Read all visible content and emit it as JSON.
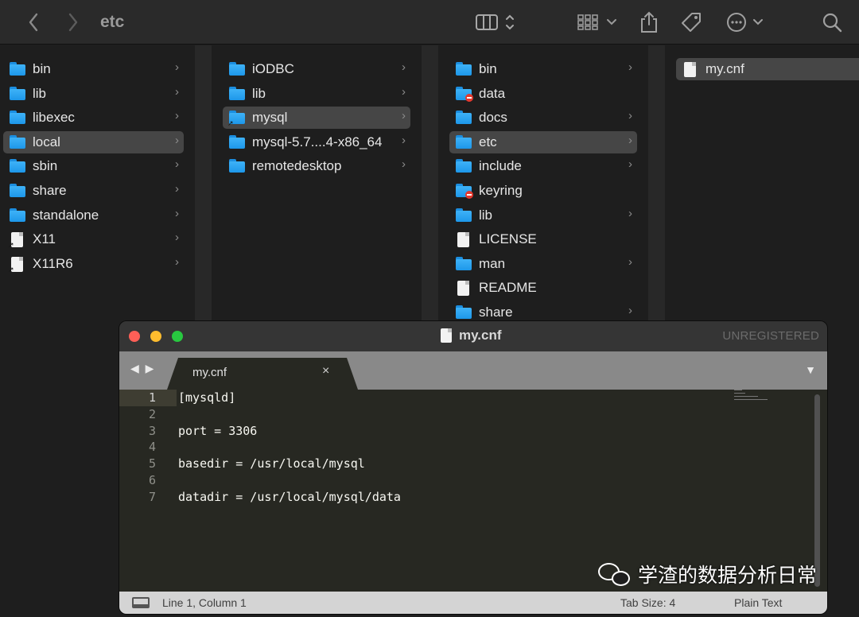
{
  "finder": {
    "title": "etc",
    "icons": {
      "back": "chevron-left-icon",
      "forward": "chevron-right-icon",
      "view": "column-view-icon",
      "group": "group-icon",
      "share": "share-icon",
      "tag": "tag-icon",
      "more": "more-icon",
      "search": "search-icon"
    },
    "columns": [
      {
        "items": [
          {
            "label": "bin",
            "icon": "folder",
            "chevron": true,
            "selected": false
          },
          {
            "label": "lib",
            "icon": "folder",
            "chevron": true,
            "selected": false
          },
          {
            "label": "libexec",
            "icon": "folder",
            "chevron": true,
            "selected": false
          },
          {
            "label": "local",
            "icon": "folder",
            "chevron": true,
            "selected": true
          },
          {
            "label": "sbin",
            "icon": "folder",
            "chevron": true,
            "selected": false
          },
          {
            "label": "share",
            "icon": "folder",
            "chevron": true,
            "selected": false
          },
          {
            "label": "standalone",
            "icon": "folder",
            "chevron": true,
            "selected": false
          },
          {
            "label": "X11",
            "icon": "alias-doc",
            "chevron": true,
            "selected": false
          },
          {
            "label": "X11R6",
            "icon": "alias-doc",
            "chevron": true,
            "selected": false
          }
        ]
      },
      {
        "items": [
          {
            "label": "iODBC",
            "icon": "folder",
            "chevron": true,
            "selected": false
          },
          {
            "label": "lib",
            "icon": "folder",
            "chevron": true,
            "selected": false
          },
          {
            "label": "mysql",
            "icon": "alias-folder",
            "chevron": true,
            "selected": true
          },
          {
            "label": "mysql-5.7....4-x86_64",
            "icon": "folder",
            "chevron": true,
            "selected": false
          },
          {
            "label": "remotedesktop",
            "icon": "folder",
            "chevron": true,
            "selected": false
          }
        ]
      },
      {
        "items": [
          {
            "label": "bin",
            "icon": "folder",
            "chevron": true,
            "selected": false
          },
          {
            "label": "data",
            "icon": "locked-folder",
            "chevron": false,
            "selected": false
          },
          {
            "label": "docs",
            "icon": "folder",
            "chevron": true,
            "selected": false
          },
          {
            "label": "etc",
            "icon": "folder",
            "chevron": true,
            "selected": true
          },
          {
            "label": "include",
            "icon": "folder",
            "chevron": true,
            "selected": false
          },
          {
            "label": "keyring",
            "icon": "locked-folder",
            "chevron": false,
            "selected": false
          },
          {
            "label": "lib",
            "icon": "folder",
            "chevron": true,
            "selected": false
          },
          {
            "label": "LICENSE",
            "icon": "doc",
            "chevron": false,
            "selected": false
          },
          {
            "label": "man",
            "icon": "folder",
            "chevron": true,
            "selected": false
          },
          {
            "label": "README",
            "icon": "doc",
            "chevron": false,
            "selected": false
          },
          {
            "label": "share",
            "icon": "folder",
            "chevron": true,
            "selected": false
          }
        ]
      },
      {
        "items": [
          {
            "label": "my.cnf",
            "icon": "doc",
            "chevron": false,
            "selected": true
          }
        ]
      }
    ]
  },
  "editor": {
    "window_title": "my.cnf",
    "unregistered": "UNREGISTERED",
    "tab_label": "my.cnf",
    "tab_close": "×",
    "nav_arrows": "◀ ▶",
    "dropdown_arrow": "▼",
    "lines": [
      {
        "n": "1",
        "text": "[mysqld]"
      },
      {
        "n": "2",
        "text": ""
      },
      {
        "n": "3",
        "text": "port = 3306"
      },
      {
        "n": "4",
        "text": ""
      },
      {
        "n": "5",
        "text": "basedir = /usr/local/mysql"
      },
      {
        "n": "6",
        "text": ""
      },
      {
        "n": "7",
        "text": "datadir = /usr/local/mysql/data"
      }
    ],
    "status": {
      "position": "Line 1, Column 1",
      "tab_size": "Tab Size: 4",
      "syntax": "Plain Text"
    },
    "colors": {
      "close": "#ff5f57",
      "minimize": "#febc2e",
      "zoom": "#28c840",
      "background": "#272822"
    }
  },
  "watermark": {
    "text": "学渣的数据分析日常",
    "icon": "wechat-icon"
  }
}
